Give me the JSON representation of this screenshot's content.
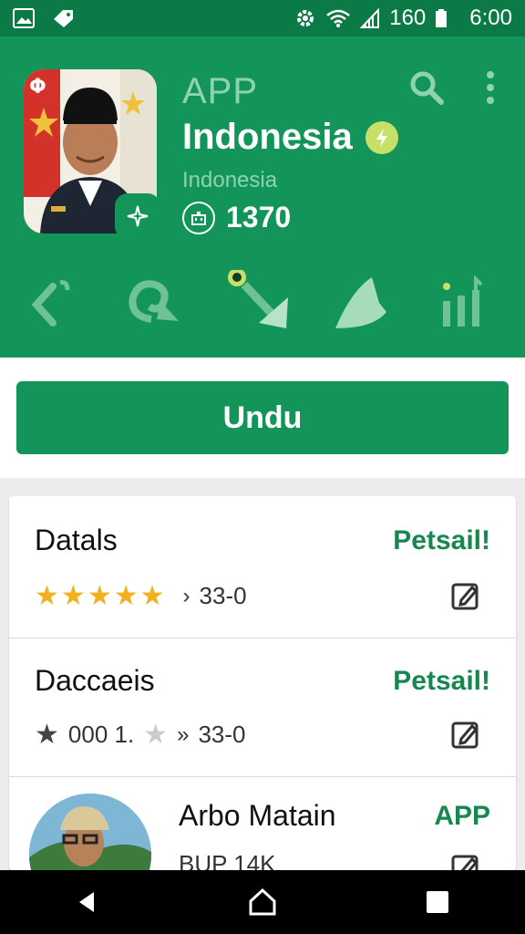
{
  "status_bar": {
    "signal_text": "160",
    "time": "6:00"
  },
  "header": {
    "small_label": "APP",
    "title": "Indonesia",
    "subtitle": "Indonesia",
    "downloads": "1370",
    "icons": [
      "flag-glyph",
      "search-icon",
      "more-vert-icon",
      "verified-icon",
      "robot-icon",
      "sparkle-icon"
    ]
  },
  "actions": [
    "back-curve-icon",
    "swirl-icon",
    "cursor-arrow-icon",
    "leaf-icon",
    "bars-icon"
  ],
  "install": {
    "label": "Undu"
  },
  "list": [
    {
      "title": "Datals",
      "action": "Petsail!",
      "rating_stars": 5,
      "meta": "33-0"
    },
    {
      "title": "Daccaeis",
      "action": "Petsail!",
      "meta_prefix": "000 1.",
      "meta": "33-0"
    },
    {
      "title": "Arbo Matain",
      "action": "APP",
      "meta": "BUP 14K"
    }
  ],
  "colors": {
    "primary": "#13955a",
    "status_bar": "#0b7a47",
    "accent_text": "#15874f",
    "star": "#f2b01e"
  }
}
